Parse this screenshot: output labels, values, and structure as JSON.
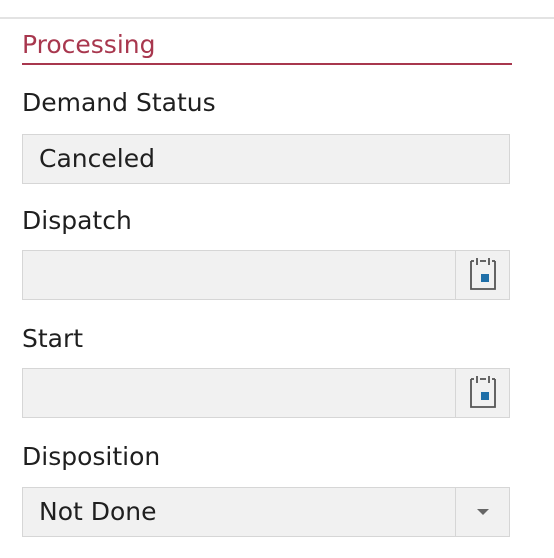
{
  "section": {
    "title": "Processing"
  },
  "fields": {
    "demand_status": {
      "label": "Demand Status",
      "value": "Canceled"
    },
    "dispatch": {
      "label": "Dispatch",
      "value": "",
      "icon": "calendar-icon"
    },
    "start": {
      "label": "Start",
      "value": "",
      "icon": "calendar-icon"
    },
    "disposition": {
      "label": "Disposition",
      "value": "Not Done",
      "icon": "chevron-down-icon"
    }
  },
  "colors": {
    "section_accent": "#a8374e",
    "calendar_accent": "#1f6fa8",
    "field_background": "#f1f1f1"
  }
}
